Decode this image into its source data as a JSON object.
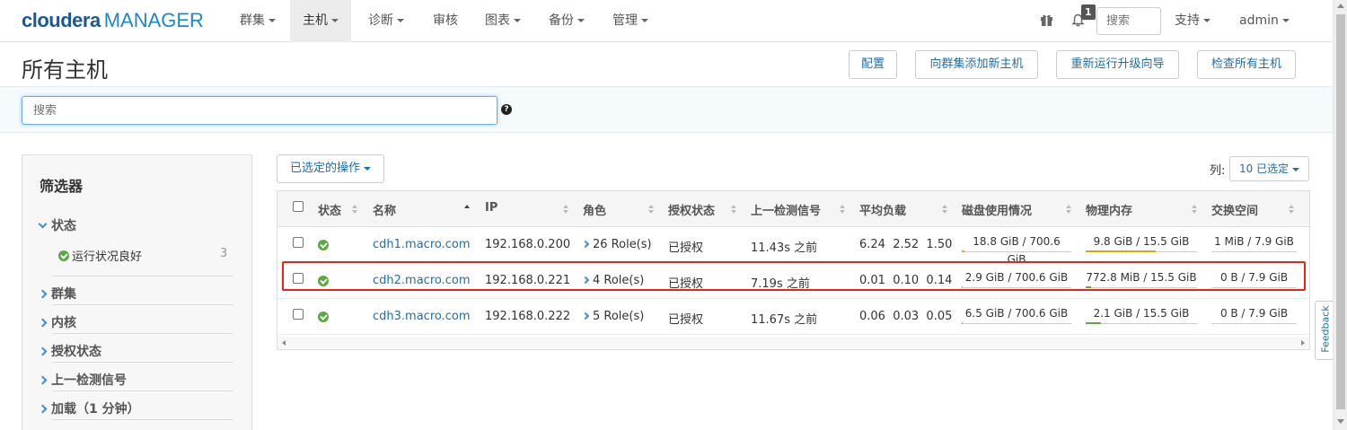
{
  "brand": {
    "name": "cloudera",
    "product": "MANAGER"
  },
  "nav": {
    "items": [
      {
        "label": "群集",
        "caret": true
      },
      {
        "label": "主机",
        "caret": true,
        "active": true
      },
      {
        "label": "诊断",
        "caret": true
      },
      {
        "label": "审核",
        "caret": false
      },
      {
        "label": "图表",
        "caret": true
      },
      {
        "label": "备份",
        "caret": true
      },
      {
        "label": "管理",
        "caret": true
      }
    ],
    "notification_count": "1",
    "search_placeholder": "搜索",
    "support_label": "支持",
    "user_label": "admin"
  },
  "page": {
    "title": "所有主机",
    "buttons": [
      "配置",
      "向群集添加新主机",
      "重新运行升级向导",
      "检查所有主机"
    ]
  },
  "search": {
    "placeholder": "搜索",
    "help_icon": "question-circle-icon"
  },
  "filters": {
    "title": "筛选器",
    "status_label": "状态",
    "status_sub": {
      "label": "运行状况良好",
      "count": "3"
    },
    "groups": [
      "群集",
      "内核",
      "授权状态",
      "上一检测信号",
      "加载（1 分钟）"
    ]
  },
  "actions": {
    "selected_label": "已选定的操作"
  },
  "columns": {
    "label": "列:",
    "selected": "10 已选定"
  },
  "table": {
    "headers": [
      "状态",
      "名称",
      "IP",
      "角色",
      "授权状态",
      "上一检测信号",
      "平均负载",
      "磁盘使用情况",
      "物理内存",
      "交换空间"
    ],
    "rows": [
      {
        "name": "cdh1.macro.com",
        "ip": "192.168.0.200",
        "roles": "26 Role(s)",
        "license": "已授权",
        "heartbeat": "11.43s 之前",
        "load": "6.24  2.52  1.50",
        "disk": "18.8 GiB / 700.6 GiB",
        "disk_pct": 2.7,
        "memory": "9.8 GiB / 15.5 GiB",
        "mem_pct": 63,
        "swap": "1 MiB / 7.9 GiB",
        "swap_pct": 0
      },
      {
        "name": "cdh2.macro.com",
        "ip": "192.168.0.221",
        "roles": "4 Role(s)",
        "license": "已授权",
        "heartbeat": "7.19s 之前",
        "load": "0.01  0.10  0.14",
        "disk": "2.9 GiB / 700.6 GiB",
        "disk_pct": 0.4,
        "memory": "772.8 MiB / 15.5 GiB",
        "mem_pct": 5,
        "swap": "0 B / 7.9 GiB",
        "swap_pct": 0
      },
      {
        "name": "cdh3.macro.com",
        "ip": "192.168.0.222",
        "roles": "5 Role(s)",
        "license": "已授权",
        "heartbeat": "11.67s 之前",
        "load": "0.06  0.03  0.05",
        "disk": "6.5 GiB / 700.6 GiB",
        "disk_pct": 0.9,
        "memory": "2.1 GiB / 15.5 GiB",
        "mem_pct": 14,
        "swap": "0 B / 7.9 GiB",
        "swap_pct": 0
      }
    ]
  },
  "feedback_label": "Feedback",
  "colors": {
    "accent": "#1e6ea8",
    "ok": "#5aa942",
    "highlight": "#e5231f",
    "disk_bar": "#e0a800",
    "mem_bar": "#e0a800",
    "mem_bar_low": "#5aa942"
  }
}
